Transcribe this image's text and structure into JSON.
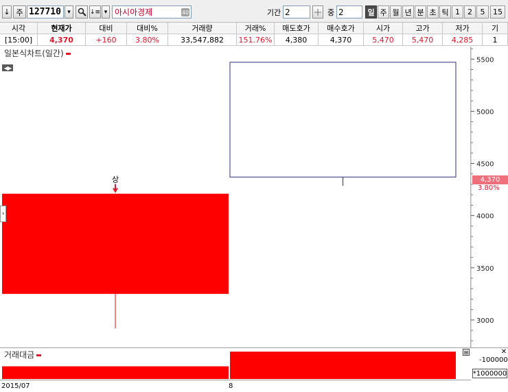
{
  "toolbar": {
    "arrow_down": "↓",
    "type_label": "주",
    "code": "127710",
    "dropdown_arrow": "▾",
    "search_icon": "magnifier-icon",
    "sort_label": "↓≡",
    "stock_name": "아시아경제",
    "name_badge": "40",
    "period_label": "기간",
    "period_value": "2",
    "middle_label": "중",
    "middle_value": "2",
    "periods": [
      "일",
      "주",
      "월",
      "년",
      "분",
      "초",
      "틱",
      "1",
      "2",
      "5",
      "15"
    ],
    "active_period": "일"
  },
  "quote": {
    "headers": [
      "시각",
      "현재가",
      "대비",
      "대비%",
      "거래량",
      "거래%",
      "매도호가",
      "매수호가",
      "시가",
      "고가",
      "저가",
      "기"
    ],
    "values": [
      "[15:00]",
      "4,370",
      "+160",
      "3.80%",
      "33,547,882",
      "151.76%",
      "4,380",
      "4,370",
      "5,470",
      "5,470",
      "4,285",
      "1"
    ]
  },
  "chart": {
    "title": "일본식차트(일간)",
    "scroll_arrows": "◀▶",
    "side_handle": "›",
    "limit_label": "상",
    "current_price_tag": "4,370",
    "current_pct_tag": "3.80%"
  },
  "chart_data": {
    "type": "candlestick",
    "categories": [
      "2015/07",
      "8"
    ],
    "candles": [
      {
        "open": 3250,
        "high": 4200,
        "low": 2920,
        "close": 4210,
        "color": "#ff0000",
        "style": "rising"
      },
      {
        "open": 5470,
        "high": 5470,
        "low": 4285,
        "close": 4370,
        "color": "#ffffff",
        "style": "falling"
      }
    ],
    "y_ticks": [
      5500,
      5000,
      4500,
      4000,
      3500,
      3000
    ],
    "ylim": [
      2730,
      5620
    ],
    "volume": {
      "title": "거래대금",
      "unit": "*1000000",
      "tick": "100000",
      "values": [
        63000,
        136000
      ],
      "ylim": [
        0,
        150000
      ]
    }
  },
  "date_axis": [
    "2015/07",
    "8"
  ],
  "colors": {
    "up": "#ff0000",
    "down_border": "#2c2c7a",
    "accent": "#e0162b"
  }
}
